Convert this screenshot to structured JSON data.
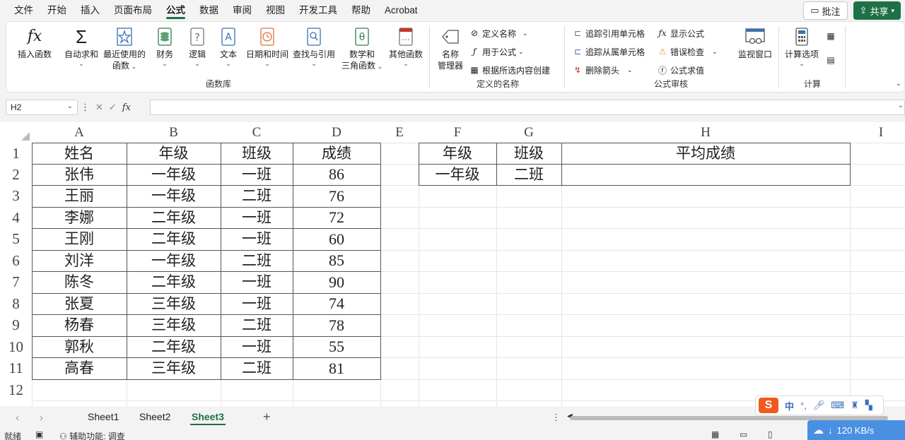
{
  "menu": {
    "tabs": [
      "文件",
      "开始",
      "插入",
      "页面布局",
      "公式",
      "数据",
      "审阅",
      "视图",
      "开发工具",
      "帮助",
      "Acrobat"
    ],
    "active_tab": "公式",
    "comment_label": "批注",
    "share_label": "共享"
  },
  "ribbon": {
    "insert_function": "插入函数",
    "autosum": "自动求和",
    "recent": "最近使用的",
    "recent2": "函数",
    "finance": "财务",
    "logic": "逻辑",
    "text": "文本",
    "datetime": "日期和时间",
    "lookup": "查找与引用",
    "math": "数学和",
    "math2": "三角函数",
    "other": "其他函数",
    "group_library": "函数库",
    "name_mgr": "名称",
    "name_mgr2": "管理器",
    "define_name": "定义名称",
    "use_in_formula": "用于公式",
    "create_from_sel": "根据所选内容创建",
    "group_names": "定义的名称",
    "trace_precedents": "追踪引用单元格",
    "trace_dependents": "追踪从属单元格",
    "remove_arrows": "删除箭头",
    "show_formulas": "显示公式",
    "error_check": "错误检查",
    "evaluate": "公式求值",
    "group_audit": "公式审核",
    "watch": "监视窗口",
    "calc_options": "计算选项",
    "group_calc": "计算"
  },
  "formula_bar": {
    "name_box": "H2",
    "fx": "fx",
    "content": ""
  },
  "columns": [
    "A",
    "B",
    "C",
    "D",
    "E",
    "F",
    "G",
    "H",
    "I"
  ],
  "rows": [
    "1",
    "2",
    "3",
    "4",
    "5",
    "6",
    "7",
    "8",
    "9",
    "10",
    "11",
    "12"
  ],
  "table": {
    "headers": [
      "姓名",
      "年级",
      "班级",
      "成绩"
    ],
    "rows": [
      [
        "张伟",
        "一年级",
        "一班",
        "86"
      ],
      [
        "王丽",
        "一年级",
        "二班",
        "76"
      ],
      [
        "李娜",
        "二年级",
        "一班",
        "72"
      ],
      [
        "王刚",
        "二年级",
        "一班",
        "60"
      ],
      [
        "刘洋",
        "一年级",
        "二班",
        "85"
      ],
      [
        "陈冬",
        "二年级",
        "一班",
        "90"
      ],
      [
        "张夏",
        "三年级",
        "一班",
        "74"
      ],
      [
        "杨春",
        "三年级",
        "二班",
        "78"
      ],
      [
        "郭秋",
        "二年级",
        "一班",
        "55"
      ],
      [
        "高春",
        "三年级",
        "二班",
        "81"
      ]
    ]
  },
  "criteria": {
    "headers": [
      "年级",
      "班级",
      "平均成绩"
    ],
    "values": [
      "一年级",
      "二班",
      ""
    ]
  },
  "sheets": [
    "Sheet1",
    "Sheet2",
    "Sheet3"
  ],
  "active_sheet": "Sheet3",
  "add_sheet": "+",
  "status": {
    "ready": "就绪",
    "accessibility": "辅助功能: 调查"
  },
  "ime": {
    "logo": "S",
    "lang": "中",
    "punct": "°,"
  },
  "net": {
    "speed": "120 KB/s"
  },
  "colors": {
    "accent": "#1e7145"
  }
}
